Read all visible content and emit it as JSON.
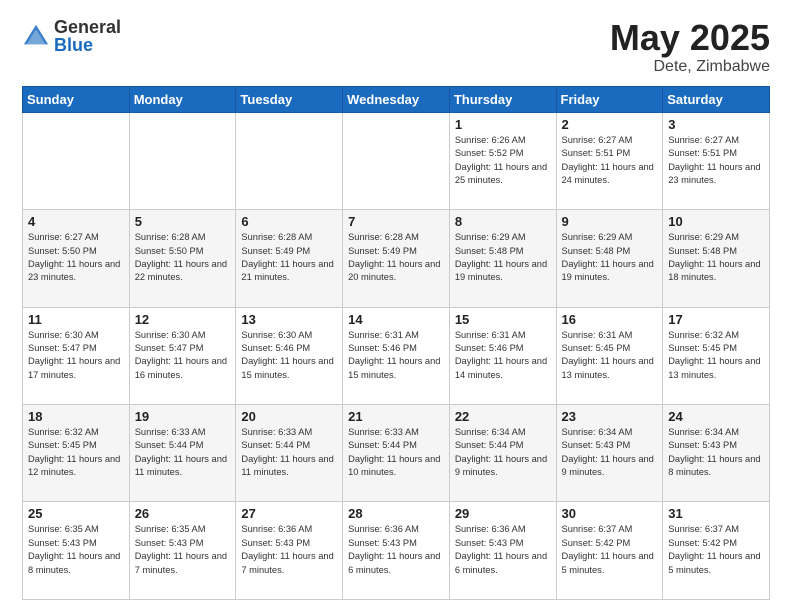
{
  "header": {
    "logo_general": "General",
    "logo_blue": "Blue",
    "title": "May 2025",
    "location": "Dete, Zimbabwe"
  },
  "weekdays": [
    "Sunday",
    "Monday",
    "Tuesday",
    "Wednesday",
    "Thursday",
    "Friday",
    "Saturday"
  ],
  "weeks": [
    [
      {
        "day": "",
        "info": ""
      },
      {
        "day": "",
        "info": ""
      },
      {
        "day": "",
        "info": ""
      },
      {
        "day": "",
        "info": ""
      },
      {
        "day": "1",
        "info": "Sunrise: 6:26 AM\nSunset: 5:52 PM\nDaylight: 11 hours and 25 minutes."
      },
      {
        "day": "2",
        "info": "Sunrise: 6:27 AM\nSunset: 5:51 PM\nDaylight: 11 hours and 24 minutes."
      },
      {
        "day": "3",
        "info": "Sunrise: 6:27 AM\nSunset: 5:51 PM\nDaylight: 11 hours and 23 minutes."
      }
    ],
    [
      {
        "day": "4",
        "info": "Sunrise: 6:27 AM\nSunset: 5:50 PM\nDaylight: 11 hours and 23 minutes."
      },
      {
        "day": "5",
        "info": "Sunrise: 6:28 AM\nSunset: 5:50 PM\nDaylight: 11 hours and 22 minutes."
      },
      {
        "day": "6",
        "info": "Sunrise: 6:28 AM\nSunset: 5:49 PM\nDaylight: 11 hours and 21 minutes."
      },
      {
        "day": "7",
        "info": "Sunrise: 6:28 AM\nSunset: 5:49 PM\nDaylight: 11 hours and 20 minutes."
      },
      {
        "day": "8",
        "info": "Sunrise: 6:29 AM\nSunset: 5:48 PM\nDaylight: 11 hours and 19 minutes."
      },
      {
        "day": "9",
        "info": "Sunrise: 6:29 AM\nSunset: 5:48 PM\nDaylight: 11 hours and 19 minutes."
      },
      {
        "day": "10",
        "info": "Sunrise: 6:29 AM\nSunset: 5:48 PM\nDaylight: 11 hours and 18 minutes."
      }
    ],
    [
      {
        "day": "11",
        "info": "Sunrise: 6:30 AM\nSunset: 5:47 PM\nDaylight: 11 hours and 17 minutes."
      },
      {
        "day": "12",
        "info": "Sunrise: 6:30 AM\nSunset: 5:47 PM\nDaylight: 11 hours and 16 minutes."
      },
      {
        "day": "13",
        "info": "Sunrise: 6:30 AM\nSunset: 5:46 PM\nDaylight: 11 hours and 15 minutes."
      },
      {
        "day": "14",
        "info": "Sunrise: 6:31 AM\nSunset: 5:46 PM\nDaylight: 11 hours and 15 minutes."
      },
      {
        "day": "15",
        "info": "Sunrise: 6:31 AM\nSunset: 5:46 PM\nDaylight: 11 hours and 14 minutes."
      },
      {
        "day": "16",
        "info": "Sunrise: 6:31 AM\nSunset: 5:45 PM\nDaylight: 11 hours and 13 minutes."
      },
      {
        "day": "17",
        "info": "Sunrise: 6:32 AM\nSunset: 5:45 PM\nDaylight: 11 hours and 13 minutes."
      }
    ],
    [
      {
        "day": "18",
        "info": "Sunrise: 6:32 AM\nSunset: 5:45 PM\nDaylight: 11 hours and 12 minutes."
      },
      {
        "day": "19",
        "info": "Sunrise: 6:33 AM\nSunset: 5:44 PM\nDaylight: 11 hours and 11 minutes."
      },
      {
        "day": "20",
        "info": "Sunrise: 6:33 AM\nSunset: 5:44 PM\nDaylight: 11 hours and 11 minutes."
      },
      {
        "day": "21",
        "info": "Sunrise: 6:33 AM\nSunset: 5:44 PM\nDaylight: 11 hours and 10 minutes."
      },
      {
        "day": "22",
        "info": "Sunrise: 6:34 AM\nSunset: 5:44 PM\nDaylight: 11 hours and 9 minutes."
      },
      {
        "day": "23",
        "info": "Sunrise: 6:34 AM\nSunset: 5:43 PM\nDaylight: 11 hours and 9 minutes."
      },
      {
        "day": "24",
        "info": "Sunrise: 6:34 AM\nSunset: 5:43 PM\nDaylight: 11 hours and 8 minutes."
      }
    ],
    [
      {
        "day": "25",
        "info": "Sunrise: 6:35 AM\nSunset: 5:43 PM\nDaylight: 11 hours and 8 minutes."
      },
      {
        "day": "26",
        "info": "Sunrise: 6:35 AM\nSunset: 5:43 PM\nDaylight: 11 hours and 7 minutes."
      },
      {
        "day": "27",
        "info": "Sunrise: 6:36 AM\nSunset: 5:43 PM\nDaylight: 11 hours and 7 minutes."
      },
      {
        "day": "28",
        "info": "Sunrise: 6:36 AM\nSunset: 5:43 PM\nDaylight: 11 hours and 6 minutes."
      },
      {
        "day": "29",
        "info": "Sunrise: 6:36 AM\nSunset: 5:43 PM\nDaylight: 11 hours and 6 minutes."
      },
      {
        "day": "30",
        "info": "Sunrise: 6:37 AM\nSunset: 5:42 PM\nDaylight: 11 hours and 5 minutes."
      },
      {
        "day": "31",
        "info": "Sunrise: 6:37 AM\nSunset: 5:42 PM\nDaylight: 11 hours and 5 minutes."
      }
    ]
  ]
}
